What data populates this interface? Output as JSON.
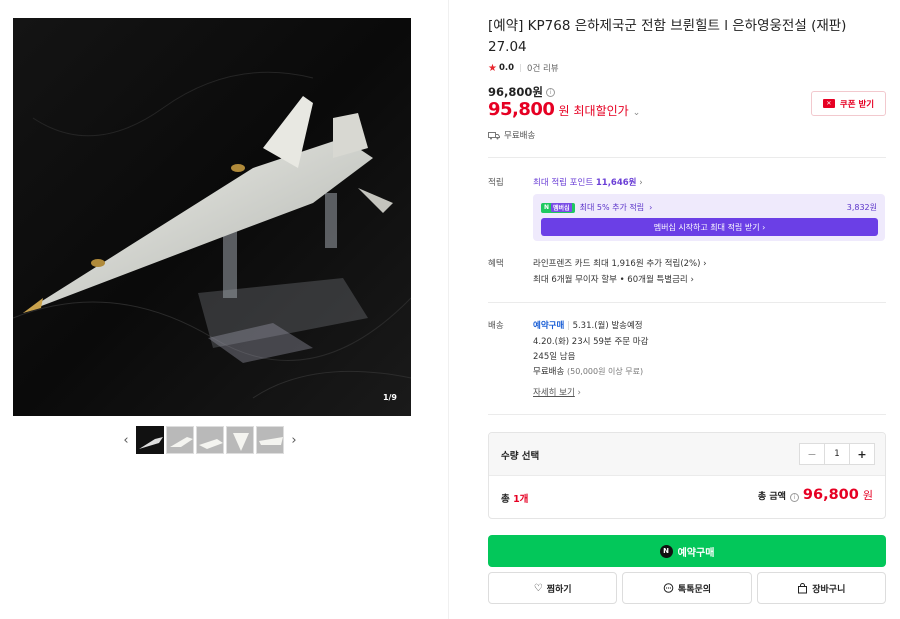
{
  "gallery": {
    "counter": "1/9",
    "prev_icon": "‹",
    "next_icon": "›"
  },
  "product": {
    "title": "[예약] KP768 은하제국군 전함 브륀힐트 l 은하영웅전설 (재판) 27.04",
    "rating_score": "0.0",
    "review_count": "0건 리뷰",
    "original_price": "96,800원",
    "sale_price": "95,800",
    "sale_won": "원",
    "sale_label": "최대할인가",
    "coupon_label": "쿠폰 받기",
    "shipping": "무료배송"
  },
  "points": {
    "label": "적립",
    "max_points_label": "최대 적립 포인트",
    "max_points_value": "11,646원",
    "member_badge_n": "N",
    "member_badge_text": "멤버십",
    "member_extra": "최대 5% 추가 적립",
    "member_points": "3,832원",
    "member_button": "멤버십 시작하고 최대 적립 받기 ›"
  },
  "benefits": {
    "label": "혜택",
    "line1": "라인프렌즈 카드 최대 1,916원 추가 적립(2%) ›",
    "line2": "최대 6개월 무이자 할부 • 60개월 특별금리 ›"
  },
  "delivery": {
    "label": "배송",
    "preorder": "예약구매",
    "ship_date": "5.31.(월) 발송예정",
    "order_deadline": "4.20.(화) 23시 59분 주문 마감",
    "remaining": "245일 남음",
    "free_shipping": "무료배송",
    "free_shipping_cond": "(50,000원 이상 무료)",
    "details_link": "자세히 보기"
  },
  "quantity": {
    "label": "수량 선택",
    "value": "1",
    "minus": "−",
    "plus": "+",
    "total_prefix": "총",
    "total_count": "1개",
    "total_amount_label": "총 금액",
    "total_amount": "96,800",
    "total_won": "원"
  },
  "actions": {
    "buy_icon": "N",
    "buy_label": "예약구매",
    "wishlist": "찜하기",
    "talktalk": "톡톡문의",
    "cart": "장바구니"
  },
  "colors": {
    "sale_red": "#e60023",
    "naver_green": "#03c75a",
    "membership_purple": "#6b3fe6"
  }
}
